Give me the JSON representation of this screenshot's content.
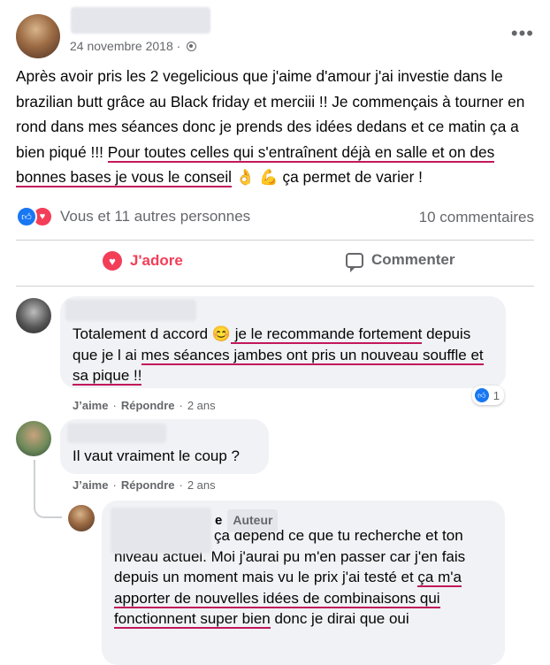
{
  "post": {
    "date": "24 novembre 2018 ·",
    "more": "•••",
    "text_part1": "Après avoir pris les 2 vegelicious que j'aime d'amour j'ai investie dans le brazilian butt grâce au Black friday et merciii !! Je commençais à tourner en rond dans mes séances donc je prends des idées dedans et ce matin ça a bien piqué !!! ",
    "text_highlight": "Pour toutes celles qui s'entraînent déjà en salle et on des bonnes bases je vous le conseil",
    "emoji": " 👌 💪 ",
    "text_part2": "ça permet de varier !"
  },
  "reactions": {
    "text": "Vous et 11 autres personnes",
    "comments": "10 commentaires"
  },
  "actions": {
    "love": "J'adore",
    "comment": "Commenter"
  },
  "comments": [
    {
      "pre": "Totalement d accord ",
      "emoji": "😊",
      "hl1": " je le recommande fortement",
      "mid": " depuis que je l ai ",
      "hl2": "mes séances jambes ont pris un nouveau souffle et sa pique !!",
      "like_label": "J’aime",
      "reply_label": "Répondre",
      "time": "2 ans",
      "likes": "1"
    },
    {
      "text": "Il vaut vraiment le coup ?",
      "like_label": "J’aime",
      "reply_label": "Répondre",
      "time": "2 ans"
    },
    {
      "name_tail": "e",
      "badge": "Auteur",
      "line1": "ça dépend ce que tu recherche et ton niveau actuel. Moi j'aurai pu m'en passer car j'en fais depuis un moment mais vu le prix j'ai testé et ",
      "hl": "ça m'a apporter de nouvelles idées de combinaisons qui fonctionnent super bien",
      "end": " donc je dirai que oui"
    }
  ],
  "colors": {
    "accent_love": "#f33e58",
    "like_blue": "#1877f2",
    "highlight_underline": "#c2185b"
  }
}
